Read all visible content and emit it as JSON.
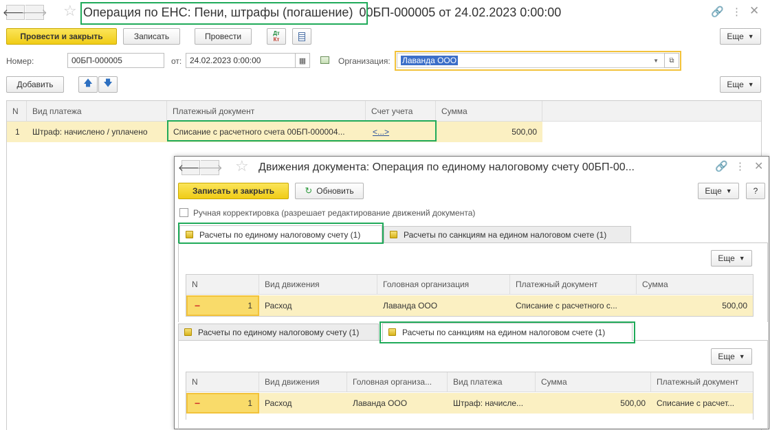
{
  "main": {
    "title_highlight": "Операция по ЕНС: Пени, штрафы (погашение)",
    "title_rest": "00БП-000005 от 24.02.2023 0:00:00",
    "toolbar": {
      "post_close": "Провести и закрыть",
      "save": "Записать",
      "post": "Провести",
      "dtkt_top": "Дт",
      "dtkt_bottom": "Кт",
      "more": "Еще"
    },
    "form": {
      "number_label": "Номер:",
      "number_value": "00БП-000005",
      "date_label": "от:",
      "date_value": "24.02.2023  0:00:00",
      "org_label": "Организация:",
      "org_value": "Лаванда ООО"
    },
    "table_toolbar": {
      "add": "Добавить",
      "more": "Еще"
    },
    "table": {
      "headers": [
        "N",
        "Вид платежа",
        "Платежный документ",
        "Счет учета",
        "Сумма"
      ],
      "rows": [
        {
          "n": "1",
          "vid": "Штраф: начислено / уплачено",
          "doc": "Списание с расчетного счета 00БП-000004...",
          "account": "<...>",
          "sum": "500,00"
        }
      ]
    }
  },
  "dialog": {
    "title": "Движения документа: Операция по единому налоговому счету 00БП-00...",
    "save_close": "Записать и закрыть",
    "refresh": "Обновить",
    "more": "Еще",
    "help": "?",
    "manual_label": "Ручная корректировка (разрешает редактирование движений документа)",
    "tab1": "Расчеты по единому налоговому счету (1)",
    "tab2": "Расчеты по санкциям на едином налоговом счете (1)",
    "section1": {
      "more": "Еще",
      "headers": [
        "N",
        "Вид движения",
        "Головная организация",
        "Платежный документ",
        "Сумма"
      ],
      "row": {
        "n": "1",
        "move": "Расход",
        "org": "Лаванда ООО",
        "doc": "Списание с расчетного с...",
        "sum": "500,00"
      }
    },
    "section2": {
      "more": "Еще",
      "headers": [
        "N",
        "Вид движения",
        "Головная организа...",
        "Вид платежа",
        "Сумма",
        "Платежный документ"
      ],
      "row": {
        "n": "1",
        "move": "Расход",
        "org": "Лаванда ООО",
        "vid": "Штраф: начисле...",
        "sum": "500,00",
        "doc": "Списание с расчет..."
      }
    }
  }
}
